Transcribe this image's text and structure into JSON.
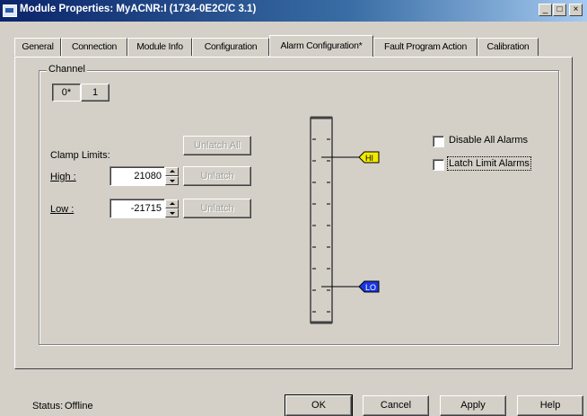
{
  "window": {
    "title": "Module Properties: MyACNR:I (1734-0E2C/C 3.1)",
    "caption_buttons": [
      "_",
      "□",
      "×"
    ]
  },
  "tabs": [
    {
      "label": "General",
      "active": false
    },
    {
      "label": "Connection",
      "active": false
    },
    {
      "label": "Module Info",
      "active": false
    },
    {
      "label": "Configuration",
      "active": false
    },
    {
      "label": "Alarm Configuration*",
      "active": true
    },
    {
      "label": "Fault Program Action",
      "active": false
    },
    {
      "label": "Calibration",
      "active": false
    }
  ],
  "channel": {
    "group_label": "Channel",
    "buttons": [
      {
        "label": "0*",
        "selected": true
      },
      {
        "label": "1",
        "selected": false
      }
    ]
  },
  "clamp": {
    "label": "Clamp Limits:",
    "unlatch_all_label": "Unlatch All",
    "high_label": "High :",
    "high_value": "21080",
    "low_label": "Low :",
    "low_value": "-21715",
    "unlatch_label": "Unlatch"
  },
  "gauge": {
    "high_marker": "HI",
    "low_marker": "LO",
    "high_color": "#f2ea00",
    "low_color": "#1836e0"
  },
  "options": {
    "disable_all_alarms_label": "Disable All Alarms",
    "disable_all_alarms_checked": false,
    "latch_limit_alarms_label": "Latch Limit Alarms",
    "latch_limit_alarms_checked": false
  },
  "status": {
    "label": "Status:",
    "value": "Offline"
  },
  "dialog_buttons": {
    "ok": "OK",
    "cancel": "Cancel",
    "apply": "Apply",
    "help": "Help"
  }
}
